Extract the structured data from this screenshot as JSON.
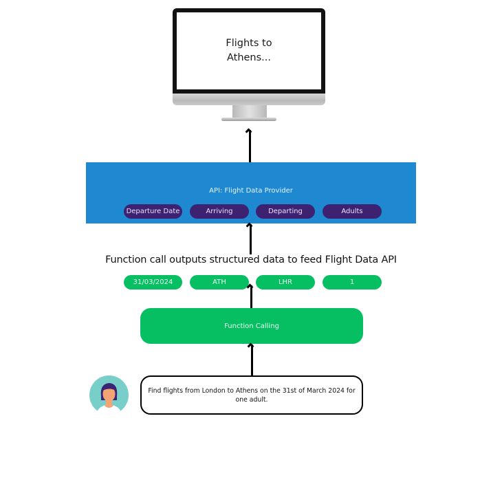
{
  "monitor": {
    "screen_text": "Flights to\nAthens..."
  },
  "api": {
    "title": "API: Flight Data Provider",
    "parameters": [
      "Departure Date",
      "Arriving",
      "Departing",
      "Adults"
    ]
  },
  "caption": "Function call outputs structured data to feed Flight Data API",
  "structured_values": [
    "31/03/2024",
    "ATH",
    "LHR",
    "1"
  ],
  "function_calling": {
    "label": "Function Calling"
  },
  "user_prompt": {
    "text": "Find flights from London to Athens on the 31st of March 2024 for one adult."
  },
  "icons": {
    "avatar": "user-avatar-icon",
    "arrows": "arrow-up-icon"
  },
  "colors": {
    "api_blue": "#1e88d0",
    "pill_purple": "#3d2272",
    "green": "#07bf63",
    "monitor_bezel": "#121212"
  }
}
